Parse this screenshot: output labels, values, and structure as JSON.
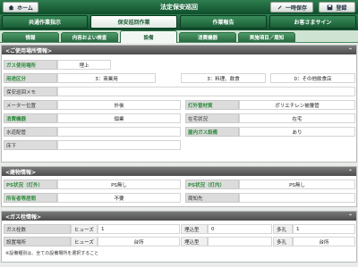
{
  "header": {
    "home": "ホーム",
    "title": "法定保安巡回",
    "save": "一時保存",
    "logout": "登録"
  },
  "nav1": [
    "共通作業指示",
    "保安巡回作業",
    "作業報告",
    "お客さまサイン"
  ],
  "nav2": [
    "情報",
    "内容およい検査",
    "設備",
    "消費機器",
    "実施項目／周知"
  ],
  "sec1": {
    "title": "<ご使用場所情報>",
    "rows": [
      {
        "l": "ガス使用場所",
        "v": "埋上"
      },
      {
        "l": "用途区分",
        "v1": "3：商業用",
        "v2": "3：料理、飲食",
        "v3": "0：その他飲食店"
      },
      {
        "l": "保安巡回メモ",
        "v": ""
      },
      {
        "l": "メーター位置",
        "v": "外後",
        "l2": "灯外管材質",
        "v2": "ポリエチレン被覆管"
      },
      {
        "l": "消費機器",
        "v": "個業",
        "l2": "在宅状況",
        "v2": "在宅"
      },
      {
        "l": "水道配管",
        "v": "",
        "l2": "屋内ガス設備",
        "v2": "あり"
      },
      {
        "l": "床下",
        "v": ""
      }
    ]
  },
  "sec2": {
    "title": "<建物情報>",
    "rows": [
      {
        "l": "PS状況（灯外）",
        "v": "PS無し",
        "l2": "PS状況（灯内）",
        "v2": "PS無し"
      },
      {
        "l": "所有者等居間",
        "v": "不要",
        "l2": "周知先",
        "v2": ""
      }
    ]
  },
  "sec3": {
    "title": "<ガス栓情報>",
    "rows": [
      {
        "l": "ガス栓数",
        "a": "ヒューズ",
        "b": "1",
        "c": "埋込型",
        "d": "0",
        "e": "多孔",
        "f": "1"
      },
      {
        "l": "設置場所",
        "a": "ヒューズ",
        "b": "台所",
        "c": "埋込型",
        "d": "",
        "e": "多孔",
        "f": "台所"
      }
    ],
    "note": "※設備種別は、全ての設備場所を選択すること"
  }
}
